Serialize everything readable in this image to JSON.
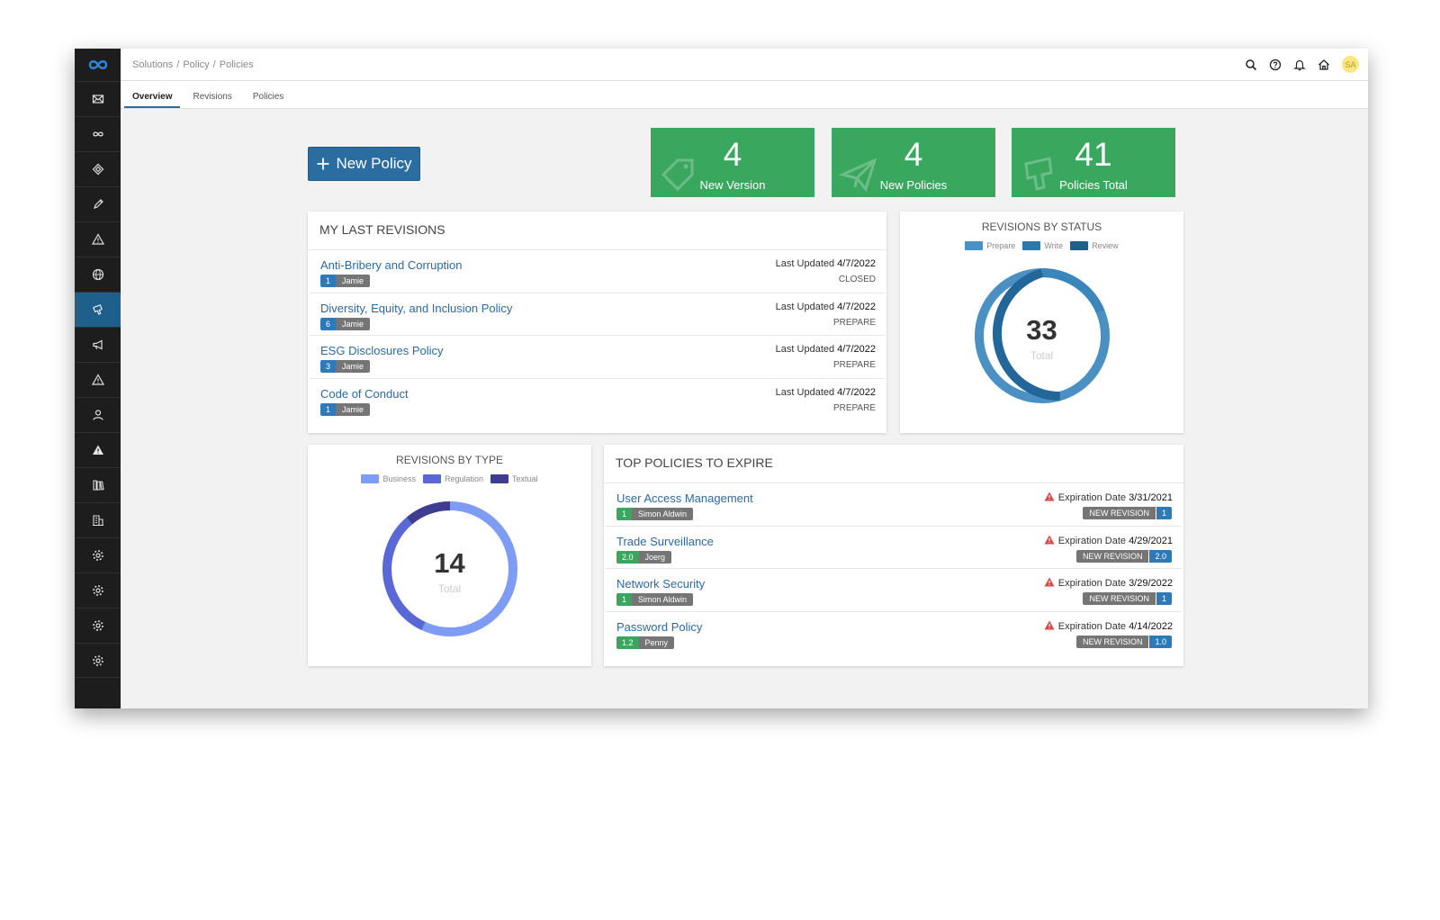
{
  "breadcrumb": [
    "Solutions",
    "Policy",
    "Policies"
  ],
  "user": {
    "initials": "SA"
  },
  "tabs": [
    "Overview",
    "Revisions",
    "Policies"
  ],
  "new_policy_label": "New Policy",
  "stats": [
    {
      "value": "4",
      "label": "New Version",
      "icon": "tag-icon"
    },
    {
      "value": "4",
      "label": "New Policies",
      "icon": "paper-plane-icon"
    },
    {
      "value": "41",
      "label": "Policies Total",
      "icon": "stamp-icon"
    }
  ],
  "last_revisions": {
    "title": "MY LAST REVISIONS",
    "updated_label": "Last Updated",
    "items": [
      {
        "name": "Anti-Bribery and Corruption",
        "version": "1",
        "user": "Jamie",
        "date": "4/7/2022",
        "status": "CLOSED"
      },
      {
        "name": "Diversity, Equity, and Inclusion Policy",
        "version": "6",
        "user": "Jamie",
        "date": "4/7/2022",
        "status": "PREPARE"
      },
      {
        "name": "ESG Disclosures Policy",
        "version": "3",
        "user": "Jamie",
        "date": "4/7/2022",
        "status": "PREPARE"
      },
      {
        "name": "Code of Conduct",
        "version": "1",
        "user": "Jamie",
        "date": "4/7/2022",
        "status": "PREPARE"
      }
    ]
  },
  "revisions_by_status": {
    "title": "REVISIONS BY STATUS",
    "total": "33",
    "total_label": "Total",
    "legend": [
      {
        "name": "Prepare",
        "color": "#4a90c2"
      },
      {
        "name": "Write",
        "color": "#2d77ab"
      },
      {
        "name": "Review",
        "color": "#1f5f8b"
      }
    ]
  },
  "revisions_by_type": {
    "title": "REVISIONS BY TYPE",
    "total": "14",
    "total_label": "Total",
    "legend": [
      {
        "name": "Business",
        "color": "#7f9cf5"
      },
      {
        "name": "Regulation",
        "color": "#5a68d6"
      },
      {
        "name": "Textual",
        "color": "#3f3d8f"
      }
    ]
  },
  "top_expire": {
    "title": "TOP POLICIES TO EXPIRE",
    "date_label": "Expiration Date",
    "action_label": "NEW REVISION",
    "items": [
      {
        "name": "User Access Management",
        "version": "1",
        "user": "Simon Aldwin",
        "date": "3/31/2021",
        "next": "1"
      },
      {
        "name": "Trade Surveillance",
        "version": "2.0",
        "user": "Joerg",
        "date": "4/29/2021",
        "next": "2.0"
      },
      {
        "name": "Network Security",
        "version": "1",
        "user": "Simon Aldwin",
        "date": "3/29/2022",
        "next": "1"
      },
      {
        "name": "Password Policy",
        "version": "1.2",
        "user": "Penny",
        "date": "4/14/2022",
        "next": "1.0"
      }
    ]
  },
  "sidebar_icons": [
    "envelope-icon",
    "infinity-icon",
    "diamond-icon",
    "pen-icon",
    "warning-icon",
    "globe-icon",
    "policy-stamp-icon",
    "megaphone-icon",
    "warning-outline-icon",
    "user-icon",
    "alert-filled-icon",
    "library-icon",
    "building-icon",
    "gear-icon",
    "gear-icon",
    "gear-icon",
    "gear-icon"
  ]
}
